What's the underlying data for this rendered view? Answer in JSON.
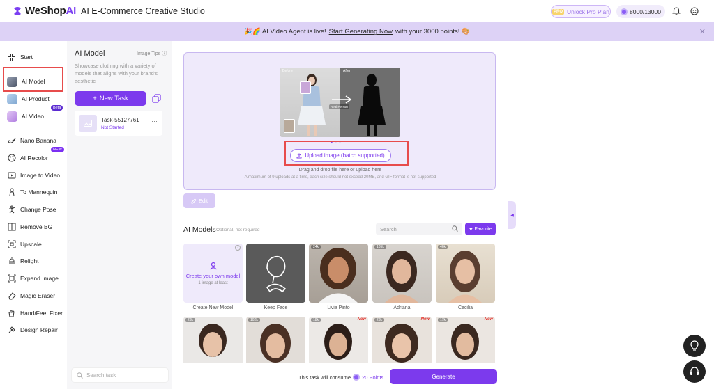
{
  "header": {
    "logo_text": "WeShop",
    "logo_ai": "AI",
    "studio_title": "AI E-Commerce Creative Studio",
    "unlock_label": "Unlock Pro Plan",
    "pro_tag": "PRO",
    "points": "8000/13000"
  },
  "banner": {
    "prefix": "🎉🌈 AI Video Agent is live!",
    "link": "Start Generating Now",
    "suffix": "with your 3000 points! 🎨",
    "close": "✕"
  },
  "sidebar": {
    "items": [
      {
        "label": "Start"
      },
      {
        "label": "AI Model"
      },
      {
        "label": "AI Product"
      },
      {
        "label": "AI Video",
        "badge": "Beta"
      },
      {
        "label": "Nano Banana"
      },
      {
        "label": "AI Recolor",
        "badge": "NEW"
      },
      {
        "label": "Image to Video"
      },
      {
        "label": "To Mannequin"
      },
      {
        "label": "Change Pose"
      },
      {
        "label": "Remove BG"
      },
      {
        "label": "Upscale"
      },
      {
        "label": "Relight"
      },
      {
        "label": "Expand Image"
      },
      {
        "label": "Magic Eraser"
      },
      {
        "label": "Hand/Feet Fixer"
      },
      {
        "label": "Design Repair"
      }
    ]
  },
  "task_panel": {
    "title": "AI Model",
    "tips": "Image Tips",
    "description": "Showcase clothing with a variety of models that aligns with your brand's aesthetic",
    "new_task": "New Task",
    "task_name": "Task-55127761",
    "task_status": "Not Started",
    "task_more": "···",
    "search_placeholder": "Search task"
  },
  "upload": {
    "before_label": "Before",
    "after_label": "After",
    "real_person": "Real Person",
    "button_label": "Upload image (batch supported)",
    "drag_text": "Drag and drop file here or upload here",
    "limit_text": "A maximum of 9 uploads at a time, each size should not exceed 20MB, and GIF format is not supported",
    "edit_label": "Edit"
  },
  "models": {
    "title": "AI Models",
    "optional": "Optional, not required",
    "search_placeholder": "Search",
    "favorite_label": "Favorite",
    "create_title": "Create your own model",
    "create_sub": "1 image at least",
    "row1": [
      {
        "label": "Create New Model"
      },
      {
        "label": "Keep Face"
      },
      {
        "label": "Livia Pinto",
        "count": "24k"
      },
      {
        "label": "Adriana",
        "count": "105k"
      },
      {
        "label": "Cecilia",
        "count": "46k"
      }
    ],
    "row2": [
      {
        "count": "23k",
        "new": ""
      },
      {
        "count": "102k",
        "new": ""
      },
      {
        "count": "18k",
        "new": "New"
      },
      {
        "count": "28k",
        "new": "New"
      },
      {
        "count": "17k",
        "new": "New"
      }
    ]
  },
  "bottom": {
    "consume_text": "This task will consume",
    "points": "20 Points",
    "generate": "Generate"
  },
  "colors": {
    "accent": "#7c3aed",
    "banner": "#ddd2f6",
    "highlight_box": "#e74c4c"
  }
}
